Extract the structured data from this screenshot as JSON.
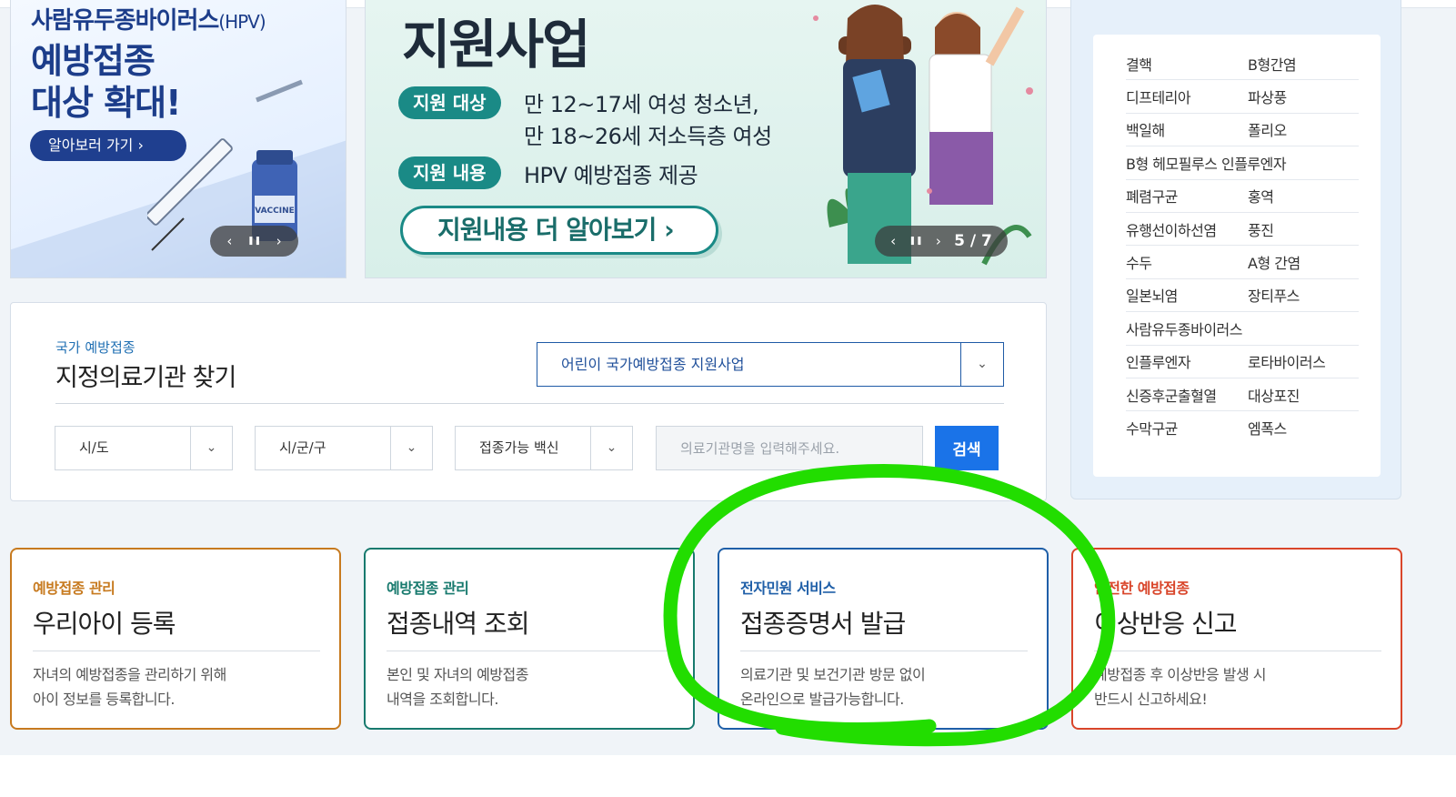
{
  "banner_left": {
    "top_line": "사람유두종바이러스",
    "top_line_suffix": "(HPV)",
    "line2": "예방접종",
    "line3": "대상 확대!",
    "button": "알아보러 가기  ›",
    "vaccine_label": "VACCINE",
    "controls": {
      "prev": "‹",
      "pause": "❚❚",
      "next": "›"
    }
  },
  "banner_mid": {
    "title": "지원사업",
    "tag1": "지원 대상",
    "tag1_text1": "만 12~17세 여성 청소년,",
    "tag1_text2": "만 18~26세 저소득층 여성",
    "tag2": "지원 내용",
    "tag2_text": "HPV 예방접종 제공",
    "button": "지원내용 더 알아보기  ›",
    "controls": {
      "prev": "‹",
      "pause": "❚❚",
      "next": "›",
      "counter": "5 / 7"
    }
  },
  "disease_list": [
    [
      "결핵",
      "B형간염"
    ],
    [
      "디프테리아",
      "파상풍"
    ],
    [
      "백일해",
      "폴리오"
    ],
    [
      "B형 헤모필루스 인플루엔자",
      ""
    ],
    [
      "폐렴구균",
      "홍역"
    ],
    [
      "유행선이하선염",
      "풍진"
    ],
    [
      "수두",
      "A형 간염"
    ],
    [
      "일본뇌염",
      "장티푸스"
    ],
    [
      "사람유두종바이러스",
      ""
    ],
    [
      "인플루엔자",
      "로타바이러스"
    ],
    [
      "신증후군출혈열",
      "대상포진"
    ],
    [
      "수막구균",
      "엠폭스"
    ]
  ],
  "search": {
    "subtitle": "국가 예방접종",
    "title": "지정의료기관 찾기",
    "program_select": "어린이 국가예방접종 지원사업",
    "sido": "시/도",
    "sigungu": "시/군/구",
    "vaccine": "접종가능 백신",
    "placeholder": "의료기관명을 입력해주세요.",
    "button": "검색"
  },
  "cards": [
    {
      "sub": "예방접종 관리",
      "title": "우리아이 등록",
      "desc": "자녀의 예방접종을 관리하기 위해\n아이 정보를 등록합니다.",
      "color": "#c77a1f"
    },
    {
      "sub": "예방접종 관리",
      "title": "접종내역 조회",
      "desc": "본인 및 자녀의 예방접종\n내역을 조회합니다.",
      "color": "#187a6e"
    },
    {
      "sub": "전자민원 서비스",
      "title": "접종증명서 발급",
      "desc": "의료기관 및 보건기관 방문 없이\n온라인으로 발급가능합니다.",
      "color": "#1f5fa8"
    },
    {
      "sub": "안전한 예방접종",
      "title": "이상반응 신고",
      "desc": "예방접종 후 이상반응 발생 시\n반드시 신고하세요!",
      "color": "#d9452a"
    }
  ],
  "colors": {
    "highlight": "#22dd00",
    "primary": "#1a73e8"
  }
}
